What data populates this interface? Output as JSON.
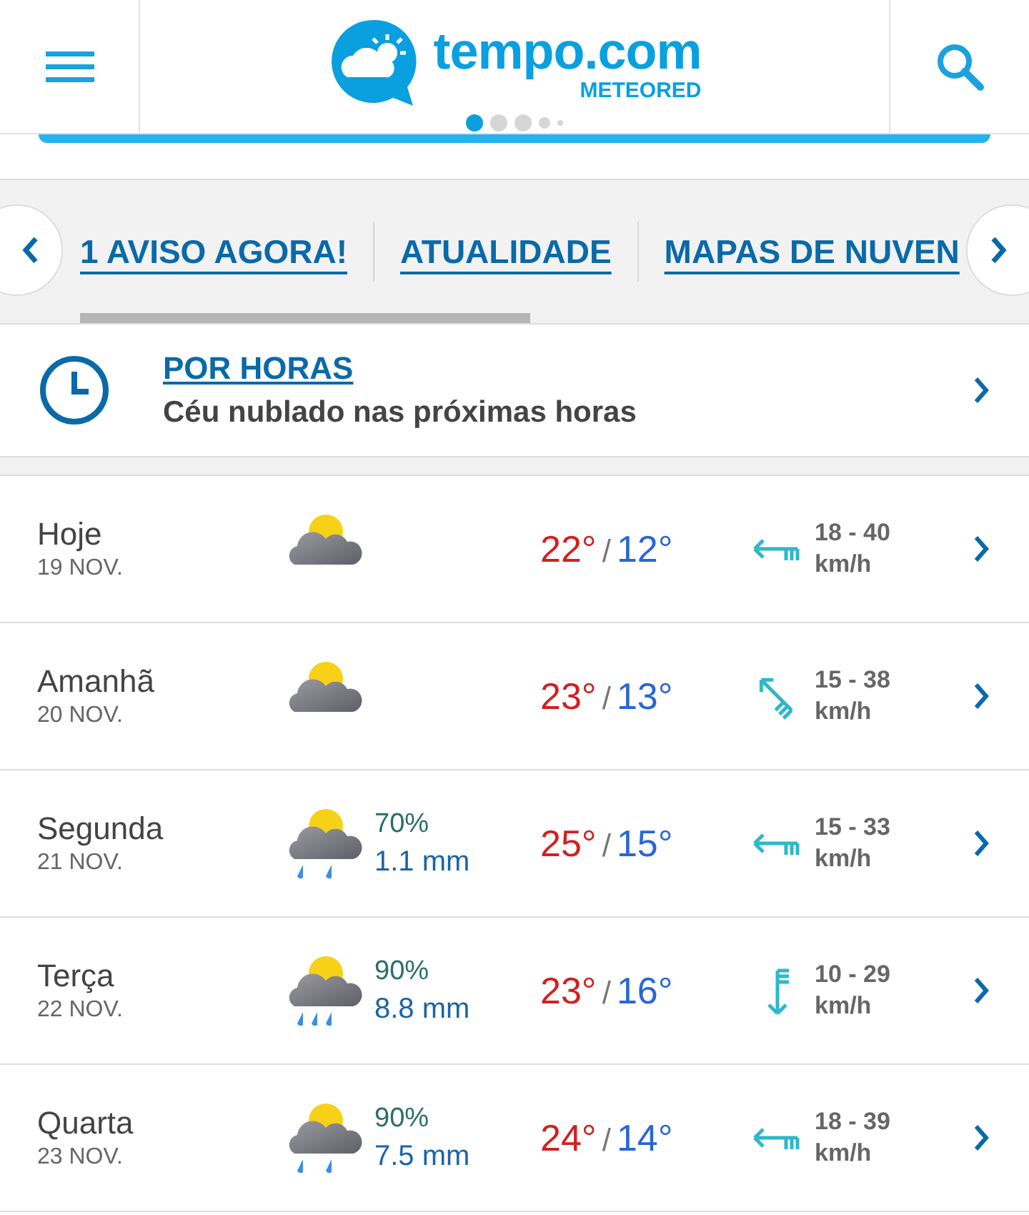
{
  "header": {
    "logo": {
      "name": "tempo.com",
      "sub": "METEORED"
    },
    "pager": [
      {
        "selected": true
      },
      {
        "selected": false
      },
      {
        "selected": false
      },
      {
        "selected": false
      },
      {
        "selected": false
      }
    ]
  },
  "nav": {
    "links": [
      "1 AVISO AGORA!",
      "ATUALIDADE",
      "MAPAS DE NUVEN"
    ]
  },
  "hourly": {
    "title": "POR HORAS",
    "subtitle": "Céu nublado nas próximas horas"
  },
  "days": [
    {
      "day": "Hoje",
      "date": "19 NOV.",
      "kind": "cloudy",
      "high": "22°",
      "separator": "/",
      "low": "12°",
      "wind": {
        "kind": "west",
        "speed": "18 - 40",
        "unit": "km/h"
      }
    },
    {
      "day": "Amanhã",
      "date": "20 NOV.",
      "kind": "cloudy",
      "high": "23°",
      "separator": "/",
      "low": "13°",
      "wind": {
        "kind": "northwest",
        "speed": "15 - 38",
        "unit": "km/h"
      }
    },
    {
      "day": "Segunda",
      "date": "21 NOV.",
      "kind": "rain",
      "chance": "70%",
      "rain": "1.1 mm",
      "high": "25°",
      "separator": "/",
      "low": "15°",
      "wind": {
        "kind": "west",
        "speed": "15 - 33",
        "unit": "km/h"
      }
    },
    {
      "day": "Terça",
      "date": "22 NOV.",
      "kind": "heavy_rain",
      "chance": "90%",
      "rain": "8.8 mm",
      "high": "23°",
      "separator": "/",
      "low": "16°",
      "wind": {
        "kind": "south",
        "speed": "10 - 29",
        "unit": "km/h"
      }
    },
    {
      "day": "Quarta",
      "date": "23 NOV.",
      "kind": "rain",
      "chance": "90%",
      "rain": "7.5 mm",
      "high": "24°",
      "separator": "/",
      "low": "14°",
      "wind": {
        "kind": "west",
        "speed": "18 - 39",
        "unit": "km/h"
      }
    }
  ]
}
